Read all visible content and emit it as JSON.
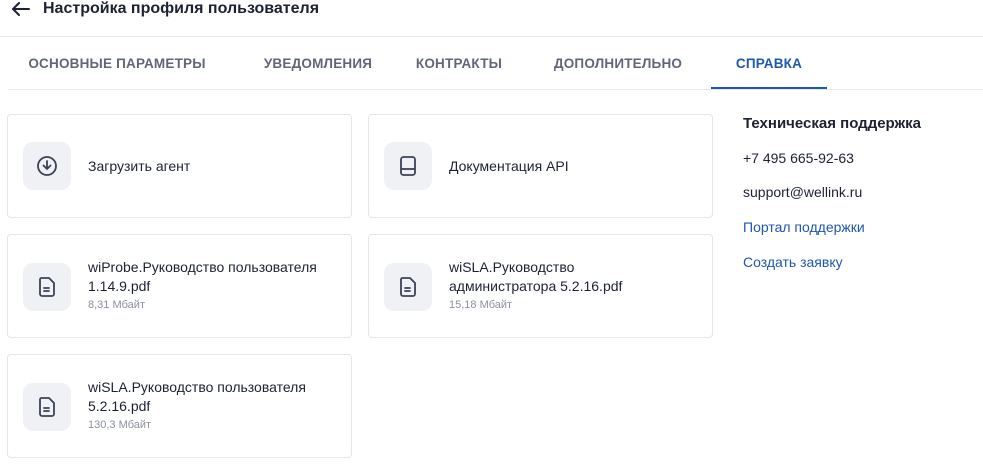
{
  "header": {
    "title": "Настройка профиля пользователя"
  },
  "tabs": [
    {
      "label": "ОСНОВНЫЕ ПАРАМЕТРЫ",
      "active": false
    },
    {
      "label": "УВЕДОМЛЕНИЯ",
      "active": false
    },
    {
      "label": "КОНТРАКТЫ",
      "active": false
    },
    {
      "label": "ДОПОЛНИТЕЛЬНО",
      "active": false
    },
    {
      "label": "СПРАВКА",
      "active": true
    }
  ],
  "cards": [
    {
      "icon": "download-icon",
      "label": "Загрузить агент"
    },
    {
      "icon": "document-icon",
      "label": "Документация API"
    },
    {
      "icon": "file-icon",
      "label_line1": "wiProbe.Руководство пользователя",
      "label_line2": "1.14.9.pdf",
      "size": "8,31 Мбайт"
    },
    {
      "icon": "file-icon",
      "label_line1": "wiSLA.Руководство",
      "label_line2": "администратора 5.2.16.pdf",
      "size": "15,18 Мбайт"
    },
    {
      "icon": "file-icon",
      "label_line1": "wiSLA.Руководство пользователя",
      "label_line2": "5.2.16.pdf",
      "size": "130,3 Мбайт"
    }
  ],
  "support": {
    "title": "Техническая поддержка",
    "phone": "+7 495 665-92-63",
    "email": "support@wellink.ru",
    "portal_link": "Портал поддержки",
    "ticket_link": "Создать заявку"
  },
  "colors": {
    "accent": "#1e56b3",
    "text": "#1c2233",
    "muted": "#5f6675",
    "border": "#e3e6ec",
    "icon_bg": "#eff1f5"
  }
}
